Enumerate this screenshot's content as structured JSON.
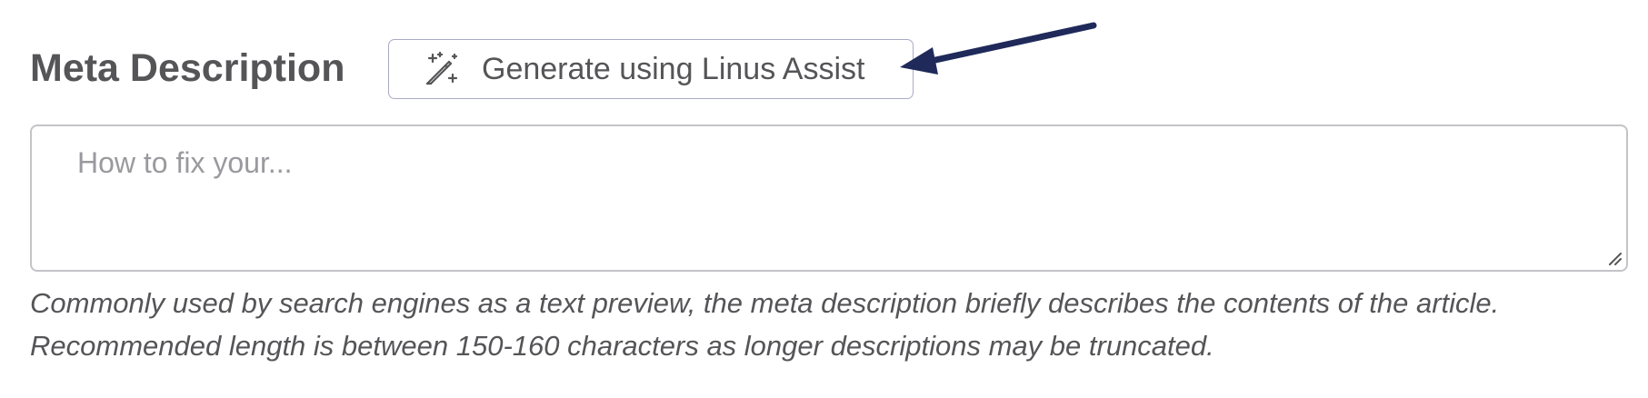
{
  "meta_description": {
    "heading": "Meta Description",
    "generate_button": {
      "label": "Generate using Linus Assist",
      "icon": "magic-wand-sparkle-icon"
    },
    "textarea": {
      "placeholder": "How to fix your...",
      "value": ""
    },
    "help_lines": [
      "Commonly used by search engines as a text preview, the meta description briefly describes the contents of the article.",
      "Recommended length is between 150-160 characters as longer descriptions may be truncated."
    ]
  },
  "annotation": {
    "arrow_color": "#1f2a5a",
    "points_to": "generate-button"
  },
  "colors": {
    "text": "#555558",
    "button_border": "#a9abc6",
    "field_border": "#c4c4c8",
    "placeholder": "#9a9a9e"
  }
}
